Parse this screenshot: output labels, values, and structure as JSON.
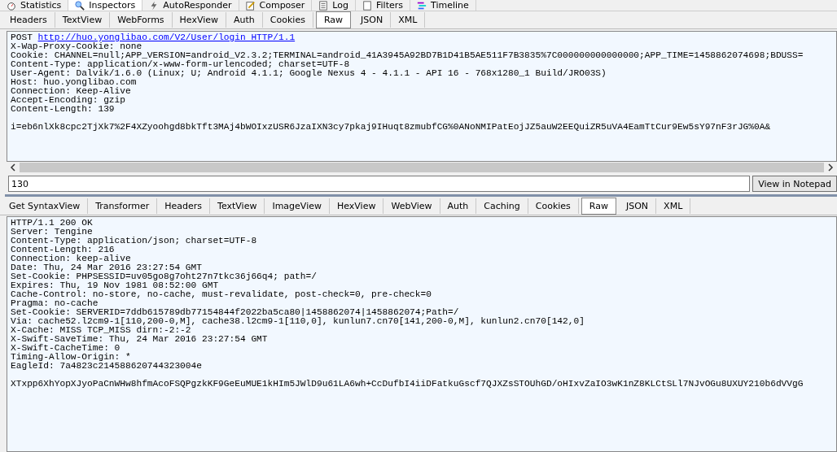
{
  "main_tabs": [
    {
      "label": "Statistics",
      "selected": false
    },
    {
      "label": "Inspectors",
      "selected": true
    },
    {
      "label": "AutoResponder",
      "selected": false
    },
    {
      "label": "Composer",
      "selected": false
    },
    {
      "label": "Log",
      "selected": false
    },
    {
      "label": "Filters",
      "selected": false
    },
    {
      "label": "Timeline",
      "selected": false
    }
  ],
  "request": {
    "tabs": [
      {
        "label": "Headers",
        "selected": false
      },
      {
        "label": "TextView",
        "selected": false
      },
      {
        "label": "WebForms",
        "selected": false
      },
      {
        "label": "HexView",
        "selected": false
      },
      {
        "label": "Auth",
        "selected": false
      },
      {
        "label": "Cookies",
        "selected": false
      },
      {
        "label": "Raw",
        "selected": true
      },
      {
        "label": "JSON",
        "selected": false
      },
      {
        "label": "XML",
        "selected": false
      }
    ],
    "method": "POST",
    "url": "http://huo.yonglibao.com/V2/User/login HTTP/1.1",
    "headers": [
      "X-Wap-Proxy-Cookie: none",
      "Cookie: CHANNEL=null;APP_VERSION=android_V2.3.2;TERMINAL=android_41A3945A92BD7B1D41B5AE511F7B3835%7C000000000000000;APP_TIME=1458862074698;BDUSS=",
      "Content-Type: application/x-www-form-urlencoded; charset=UTF-8",
      "User-Agent: Dalvik/1.6.0 (Linux; U; Android 4.1.1; Google Nexus 4 - 4.1.1 - API 16 - 768x1280_1 Build/JRO03S)",
      "Host: huo.yonglibao.com",
      "Connection: Keep-Alive",
      "Accept-Encoding: gzip",
      "Content-Length: 139"
    ],
    "body": "i=eb6nlXk8cpc2TjXk7%2F4XZyoohgd8bkTft3MAj4bWOIxzUSR6JzaIXN3cy7pkaj9IHuqt8zmubfCG%0ANoNMIPatEojJZ5auW2EEQuiZR5uVA4EamTtCur9Ew5sY97nF3rJG%0A&"
  },
  "find_field": {
    "value": "130"
  },
  "notepad_button": "View in Notepad",
  "response": {
    "tabs": [
      {
        "label": "Get SyntaxView",
        "selected": false
      },
      {
        "label": "Transformer",
        "selected": false
      },
      {
        "label": "Headers",
        "selected": false
      },
      {
        "label": "TextView",
        "selected": false
      },
      {
        "label": "ImageView",
        "selected": false
      },
      {
        "label": "HexView",
        "selected": false
      },
      {
        "label": "WebView",
        "selected": false
      },
      {
        "label": "Auth",
        "selected": false
      },
      {
        "label": "Caching",
        "selected": false
      },
      {
        "label": "Cookies",
        "selected": false
      },
      {
        "label": "Raw",
        "selected": true
      },
      {
        "label": "JSON",
        "selected": false
      },
      {
        "label": "XML",
        "selected": false
      }
    ],
    "headers": [
      "HTTP/1.1 200 OK",
      "Server: Tengine",
      "Content-Type: application/json; charset=UTF-8",
      "Content-Length: 216",
      "Connection: keep-alive",
      "Date: Thu, 24 Mar 2016 23:27:54 GMT",
      "Set-Cookie: PHPSESSID=uv05go8g7oht27n7tkc36j66q4; path=/",
      "Expires: Thu, 19 Nov 1981 08:52:00 GMT",
      "Cache-Control: no-store, no-cache, must-revalidate, post-check=0, pre-check=0",
      "Pragma: no-cache",
      "Set-Cookie: SERVERID=7ddb615789db77154844f2022ba5ca80|1458862074|1458862074;Path=/",
      "Via: cache52.l2cm9-1[110,200-0,M], cache38.l2cm9-1[110,0], kunlun7.cn70[141,200-0,M], kunlun2.cn70[142,0]",
      "X-Cache: MISS TCP_MISS dirn:-2:-2",
      "X-Swift-SaveTime: Thu, 24 Mar 2016 23:27:54 GMT",
      "X-Swift-CacheTime: 0",
      "Timing-Allow-Origin: *",
      "EagleId: 7a4823c214588620744323004e"
    ],
    "body": "XTxpp6XhYopXJyoPaCnWHw8hfmAcoFSQPgzkKF9GeEuMUE1kHIm5JWlD9u61LA6wh+CcDufbI4iiDFatkuGscf7QJXZsSTOUhGD/oHIxvZaIO3wK1nZ8KLCtSLl7NJvOGu8UXUY210b6dVVgG"
  }
}
